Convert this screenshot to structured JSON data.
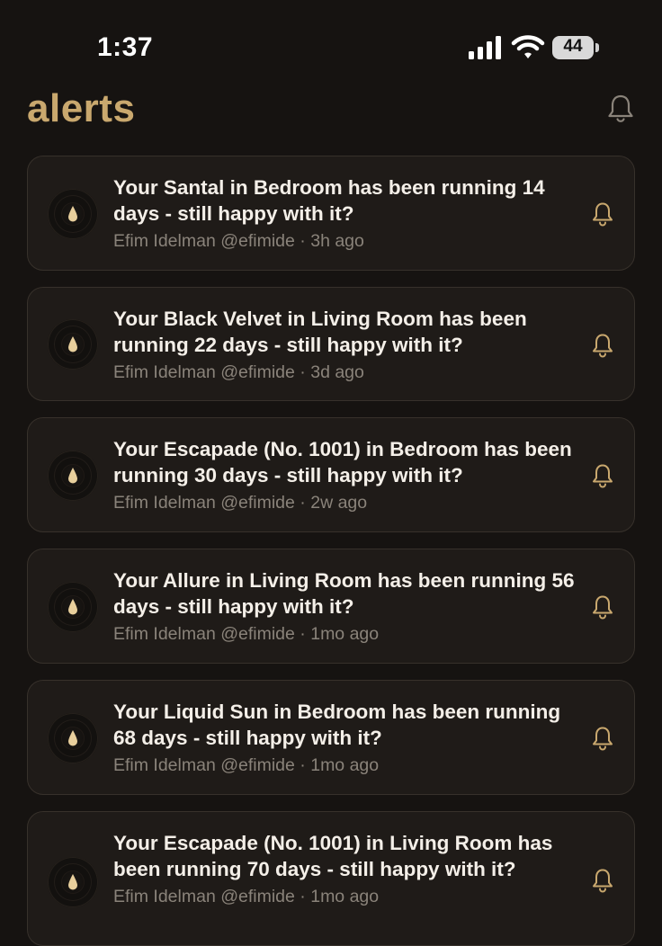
{
  "status_bar": {
    "time": "1:37",
    "battery": "44",
    "icons": [
      "signal-icon",
      "wifi-icon",
      "battery-icon"
    ]
  },
  "header": {
    "title": "alerts",
    "bell_icon": "bell-icon"
  },
  "colors": {
    "background": "#161311",
    "card": "#1f1b18",
    "accent_gold": "#c9a86e",
    "muted_text": "#8a837a"
  },
  "alerts": [
    {
      "message": "Your Santal in Bedroom has been running 14 days - still happy with it?",
      "author": "Efim Idelman @efimide",
      "time": "3h ago",
      "icon": "drop-icon"
    },
    {
      "message": "Your Black Velvet in Living Room has been running 22 days - still happy with it?",
      "author": "Efim Idelman @efimide",
      "time": "3d ago",
      "icon": "drop-icon"
    },
    {
      "message": "Your Escapade (No. 1001) in Bedroom has been running 30 days - still happy with it?",
      "author": "Efim Idelman @efimide",
      "time": "2w ago",
      "icon": "drop-icon"
    },
    {
      "message": "Your Allure in Living Room has been running 56 days - still happy with it?",
      "author": "Efim Idelman @efimide",
      "time": "1mo ago",
      "icon": "drop-icon"
    },
    {
      "message": "Your Liquid Sun in Bedroom has been running 68 days - still happy with it?",
      "author": "Efim Idelman @efimide",
      "time": "1mo ago",
      "icon": "drop-icon"
    },
    {
      "message": "Your Escapade (No. 1001) in Living Room has been running 70 days - still happy with it?",
      "author": "Efim Idelman @efimide",
      "time": "1mo ago",
      "icon": "drop-icon"
    }
  ]
}
